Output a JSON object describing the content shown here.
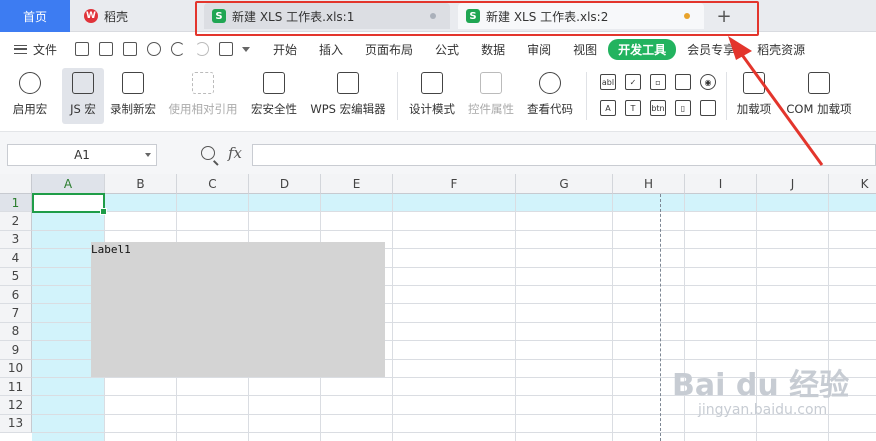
{
  "tabbar": {
    "home": "首页",
    "shell": "稻壳",
    "shell_logo": "W",
    "tabs": [
      {
        "icon": "S",
        "title": "新建 XLS 工作表.xls:1"
      },
      {
        "icon": "S",
        "title": "新建 XLS 工作表.xls:2"
      }
    ],
    "plus": "+"
  },
  "menubar": {
    "file": "文件",
    "tabs": [
      "开始",
      "插入",
      "页面布局",
      "公式",
      "数据",
      "审阅",
      "视图",
      "开发工具",
      "会员专享",
      "稻壳资源"
    ],
    "active_tab": "开发工具"
  },
  "ribbon": {
    "buttons": [
      "启用宏",
      "JS 宏",
      "录制新宏",
      "使用相对引用",
      "宏安全性",
      "WPS 宏编辑器",
      "设计模式",
      "控件属性",
      "查看代码",
      "加载项",
      "COM 加载项"
    ],
    "controls": [
      "abl",
      "✓",
      "▫",
      "◉",
      "A",
      "T",
      "btn",
      "▯"
    ]
  },
  "formula": {
    "namebox": "A1",
    "fx": "fx",
    "value": ""
  },
  "grid": {
    "columns": [
      "A",
      "B",
      "C",
      "D",
      "E",
      "F",
      "G",
      "H",
      "I",
      "J",
      "K"
    ],
    "rows": [
      "1",
      "2",
      "3",
      "4",
      "5",
      "6",
      "7",
      "8",
      "9",
      "10",
      "11",
      "12",
      "13"
    ],
    "active_cell": "A1"
  },
  "label_control": {
    "text": "Label1"
  },
  "watermark": {
    "brand": "Bai du 经验",
    "url": "jingyan.baidu.com"
  },
  "colors": {
    "accent": "#3d7cf2",
    "active_tab": "#22b35f",
    "highlight": "#e3352c",
    "selection": "#d2f3fb"
  }
}
